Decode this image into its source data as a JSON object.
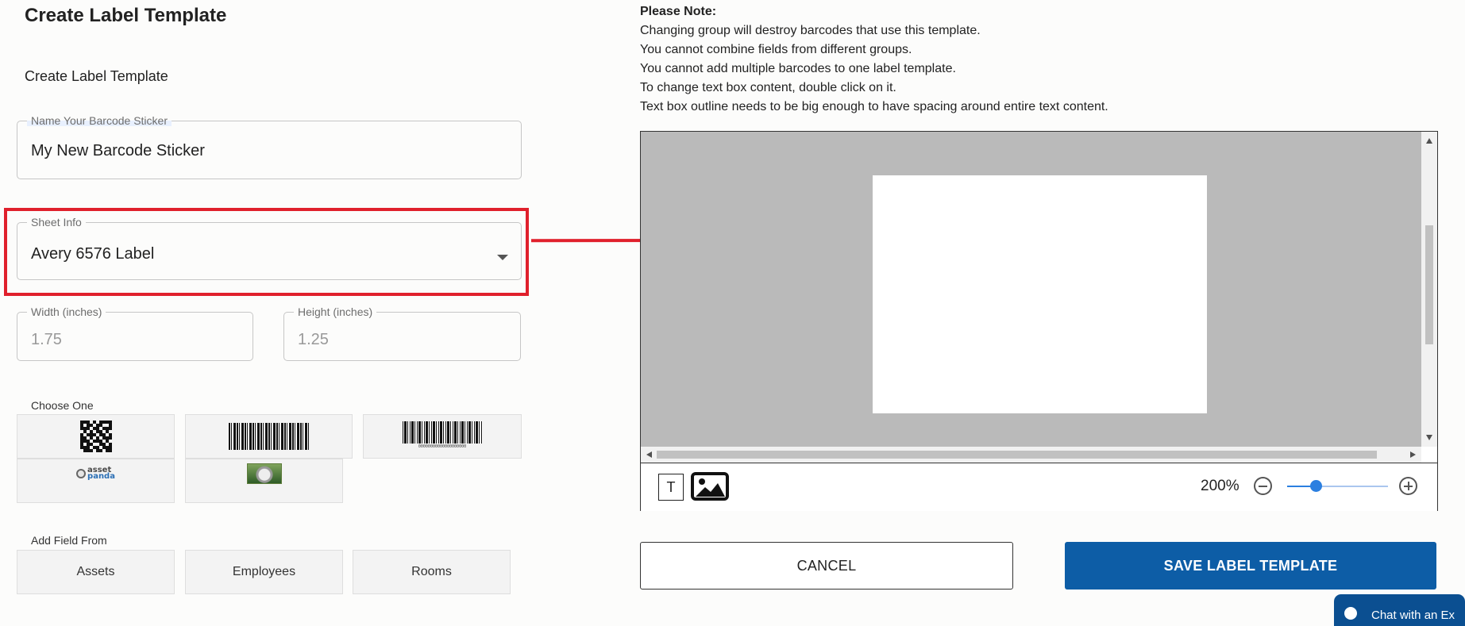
{
  "page": {
    "title": "Create Label Template",
    "subtitle": "Create Label Template"
  },
  "form": {
    "name_label": "Name Your Barcode Sticker",
    "name_value": "My New Barcode Sticker",
    "sheet_label": "Sheet Info",
    "sheet_value": "Avery 6576 Label",
    "width_label": "Width (inches)",
    "width_value": "1.75",
    "height_label": "Height (inches)",
    "height_value": "1.25"
  },
  "choose": {
    "label": "Choose One",
    "barcode_number": "00000000000000000000",
    "logo_text_top": "asset",
    "logo_text_bottom": "panda"
  },
  "add_field": {
    "label": "Add Field From",
    "buttons": [
      "Assets",
      "Employees",
      "Rooms"
    ]
  },
  "note": {
    "heading": "Please Note:",
    "lines": [
      "Changing group will destroy barcodes that use this template.",
      "You cannot combine fields from different groups.",
      "You cannot add multiple barcodes to one label template.",
      "To change text box content, double click on it.",
      "Text box outline needs to be big enough to have spacing around entire text content."
    ]
  },
  "editor": {
    "text_tool_label": "T",
    "zoom_label": "200%",
    "zoom_level": 0.28
  },
  "actions": {
    "cancel": "CANCEL",
    "save": "SAVE LABEL TEMPLATE"
  },
  "chat": {
    "label": "Chat with an Ex"
  },
  "colors": {
    "highlight": "#e0202c",
    "primary": "#0d5da6",
    "chat": "#0b4f91",
    "slider": "#2b7fe0"
  },
  "icons": [
    "qr-code-icon",
    "barcode-icon",
    "barcode-with-number-icon",
    "asset-panda-logo-icon",
    "photo-thumbnail-icon",
    "text-tool-icon",
    "image-tool-icon",
    "zoom-out-icon",
    "zoom-in-icon",
    "dropdown-caret-icon",
    "chat-icon"
  ]
}
